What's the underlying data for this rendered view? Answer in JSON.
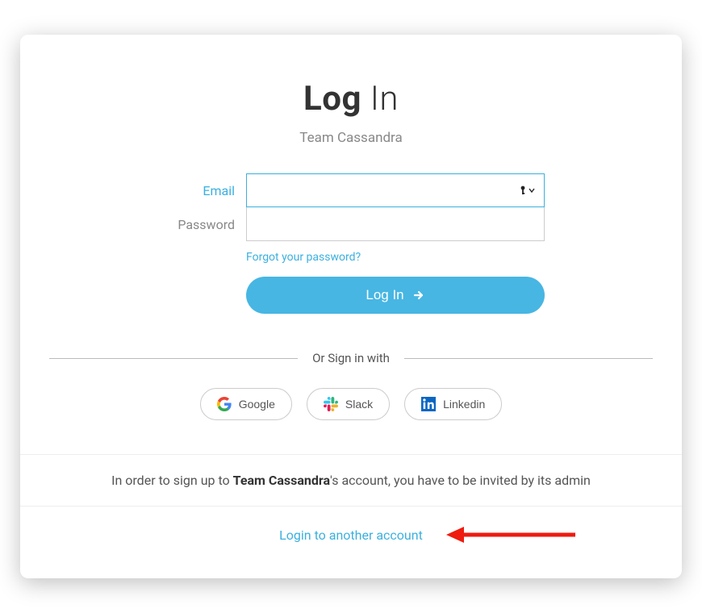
{
  "title": {
    "bold": "Log",
    "light": "In"
  },
  "subtitle": "Team Cassandra",
  "form": {
    "email_label": "Email",
    "email_value": "",
    "password_label": "Password",
    "password_value": "",
    "forgot_label": "Forgot your password?",
    "submit_label": "Log In"
  },
  "divider": "Or Sign in with",
  "social": {
    "google": "Google",
    "slack": "Slack",
    "linkedin": "Linkedin"
  },
  "invite": {
    "prefix": "In order to sign up to ",
    "team": "Team Cassandra",
    "suffix": "'s account, you have to be invited by its admin"
  },
  "footer": {
    "other_account": "Login to another account"
  }
}
